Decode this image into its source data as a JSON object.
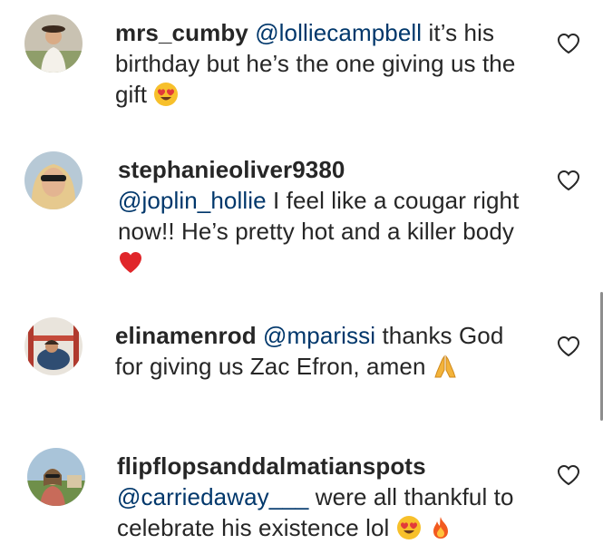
{
  "comments": [
    {
      "username": "mrs_cumby",
      "mention": "@lolliecampbell",
      "text": " it’s his birthday but he’s the one giving us the gift ",
      "emojis": [
        "heart-eyes"
      ]
    },
    {
      "username": "stephanieoliver9380",
      "mention": "@joplin_hollie",
      "text": " I feel like a cougar right now!! He’s pretty hot and a killer body",
      "emojis": [
        "red-heart"
      ]
    },
    {
      "username": "elinamenrod",
      "mention": "@mparissi",
      "text": " thanks God for giving us Zac Efron, amen ",
      "emojis": [
        "folded-hands"
      ]
    },
    {
      "username": "flipflopsanddalmatianspots",
      "mention": "@carriedaway___",
      "text": " were all thankful to celebrate his existence lol ",
      "emojis": [
        "heart-eyes",
        "fire"
      ]
    }
  ],
  "icons": {
    "like": "heart-outline-icon"
  },
  "colors": {
    "text": "#262626",
    "mention": "#00376b",
    "scrollbar": "#8e8e8e"
  }
}
